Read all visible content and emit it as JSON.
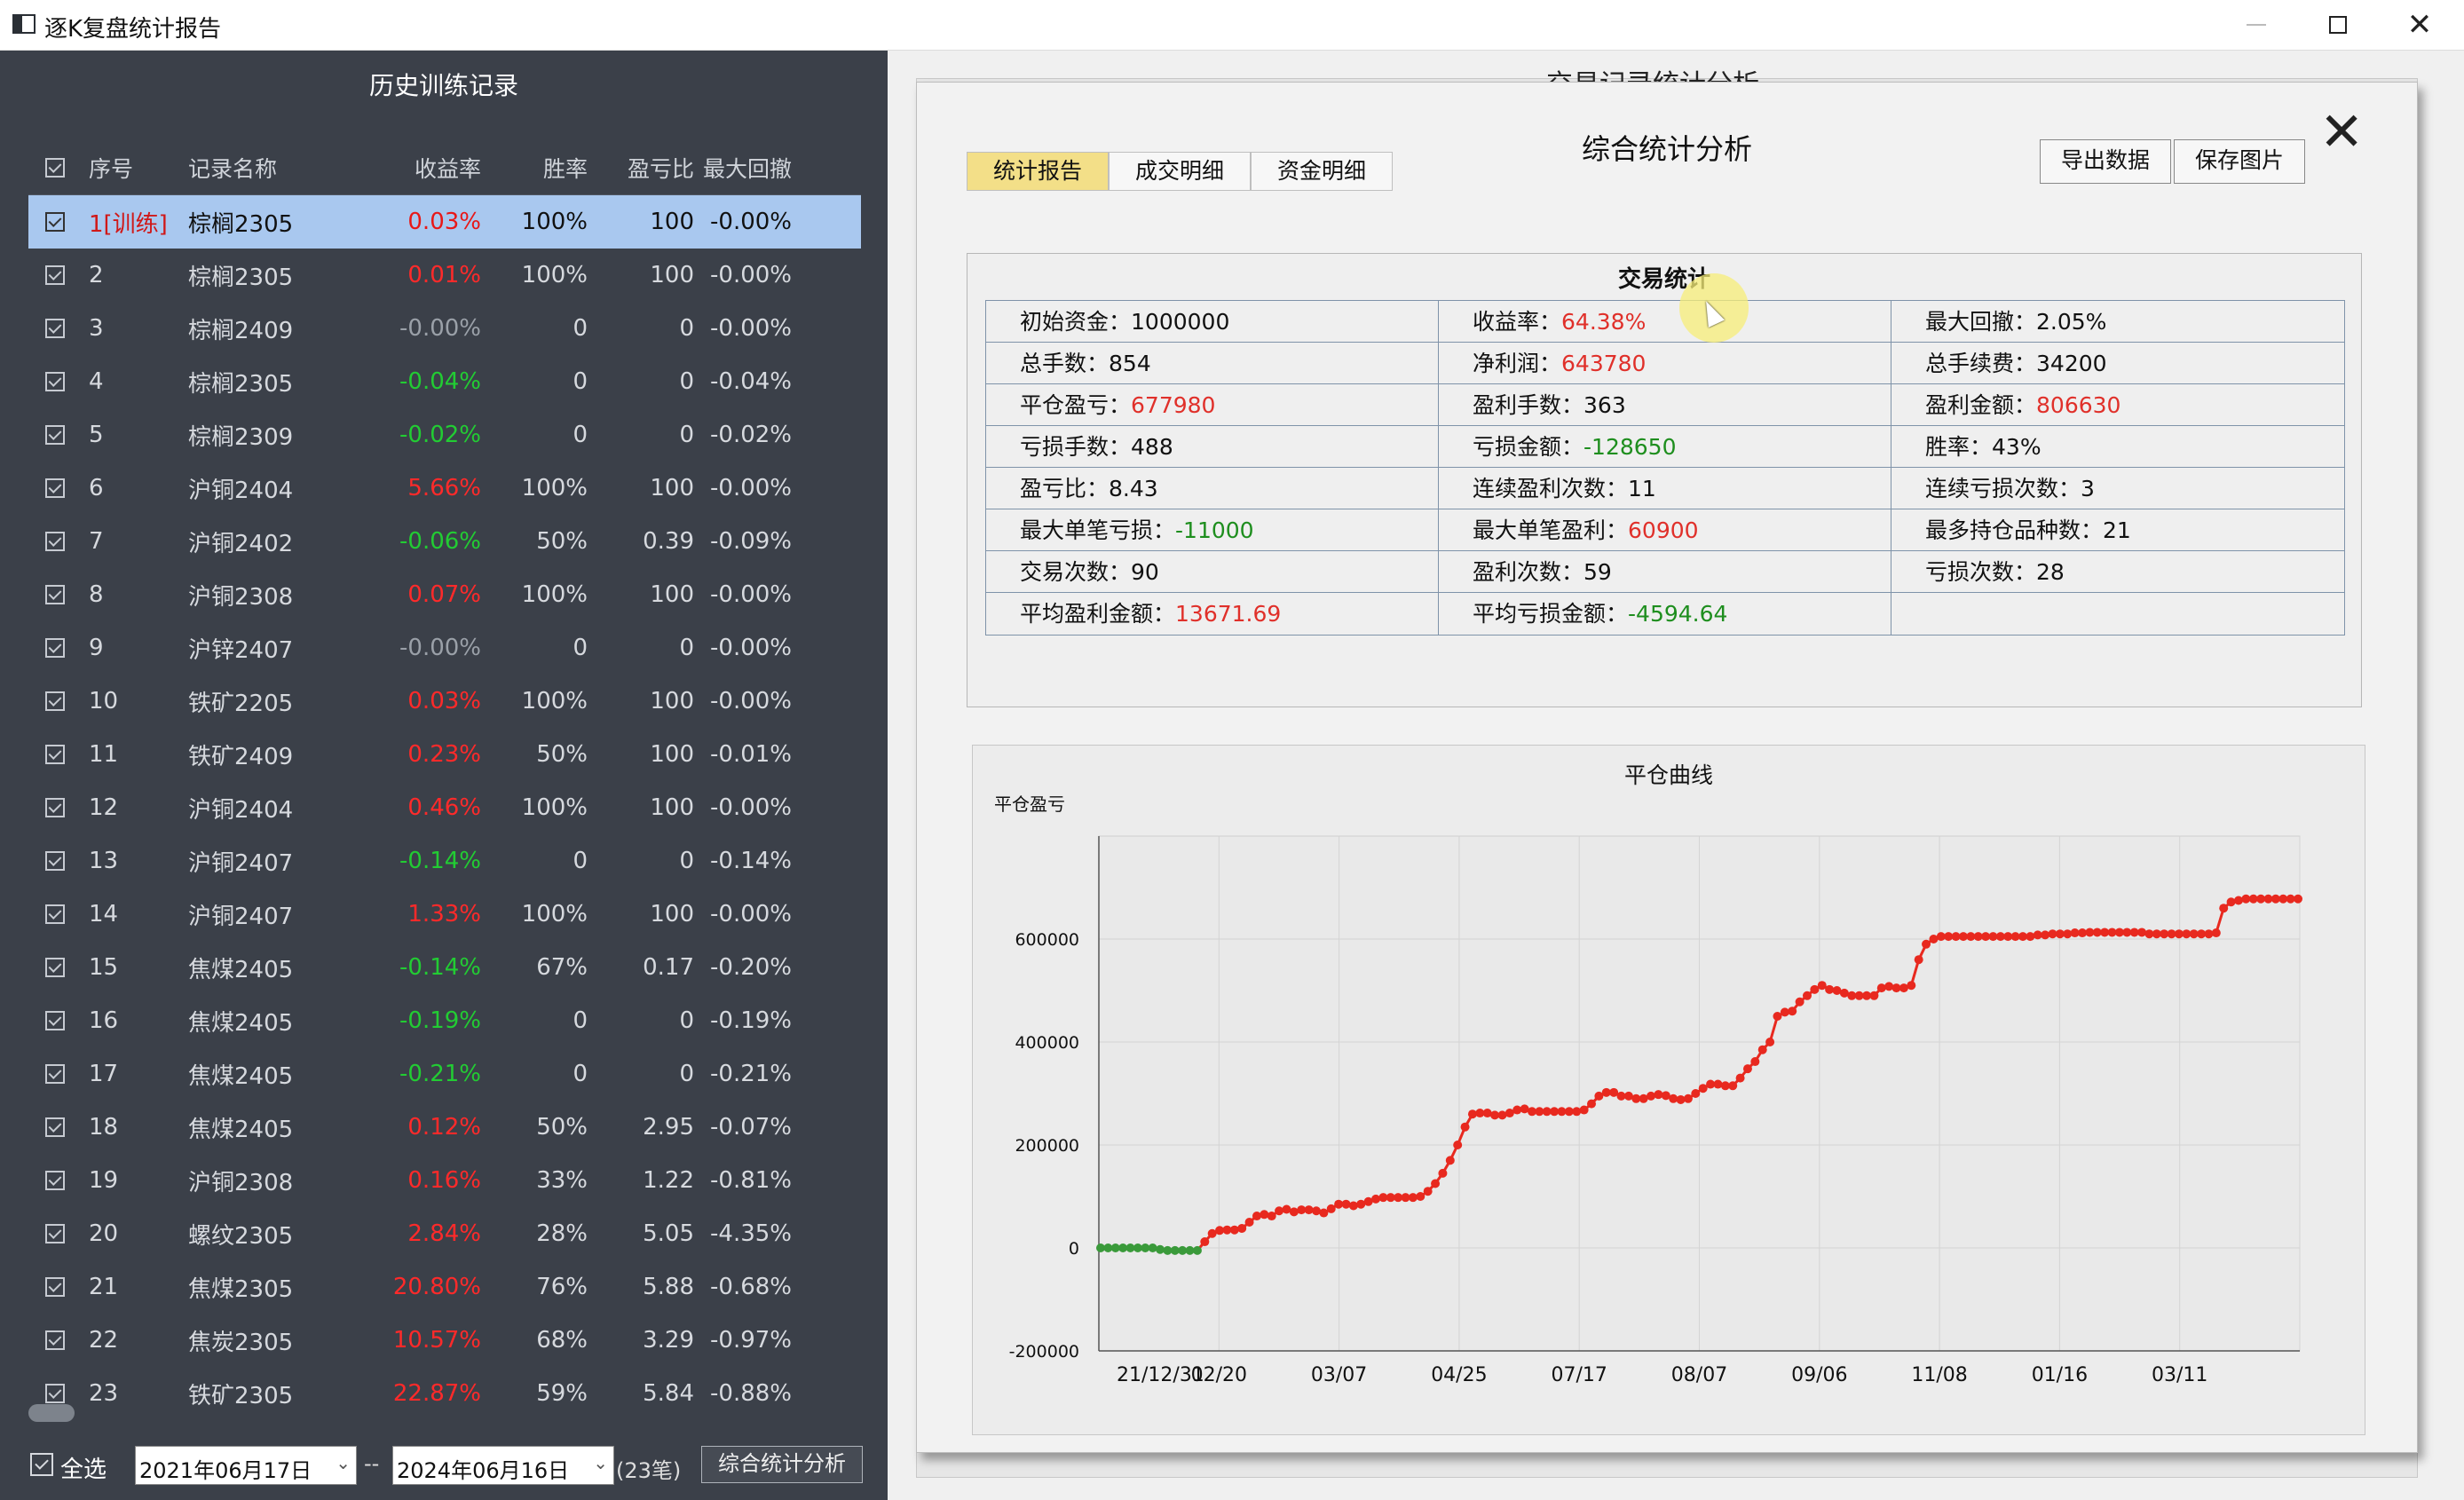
{
  "window": {
    "title": "逐K复盘统计报告"
  },
  "left_panel": {
    "title": "历史训练记录",
    "columns": [
      "序号",
      "记录名称",
      "收益率",
      "胜率",
      "盈亏比",
      "最大回撤"
    ],
    "rows": [
      {
        "no": "1[训练]",
        "name": "棕榈2305",
        "ret": "0.03%",
        "win": "100%",
        "ratio": "100",
        "dd": "-0.00%",
        "ret_color": "red"
      },
      {
        "no": "2",
        "name": "棕榈2305",
        "ret": "0.01%",
        "win": "100%",
        "ratio": "100",
        "dd": "-0.00%",
        "ret_color": "red"
      },
      {
        "no": "3",
        "name": "棕榈2409",
        "ret": "-0.00%",
        "win": "0",
        "ratio": "0",
        "dd": "-0.00%",
        "ret_color": "gray"
      },
      {
        "no": "4",
        "name": "棕榈2305",
        "ret": "-0.04%",
        "win": "0",
        "ratio": "0",
        "dd": "-0.04%",
        "ret_color": "green"
      },
      {
        "no": "5",
        "name": "棕榈2309",
        "ret": "-0.02%",
        "win": "0",
        "ratio": "0",
        "dd": "-0.02%",
        "ret_color": "green"
      },
      {
        "no": "6",
        "name": "沪铜2404",
        "ret": "5.66%",
        "win": "100%",
        "ratio": "100",
        "dd": "-0.00%",
        "ret_color": "red"
      },
      {
        "no": "7",
        "name": "沪铜2402",
        "ret": "-0.06%",
        "win": "50%",
        "ratio": "0.39",
        "dd": "-0.09%",
        "ret_color": "green"
      },
      {
        "no": "8",
        "name": "沪铜2308",
        "ret": "0.07%",
        "win": "100%",
        "ratio": "100",
        "dd": "-0.00%",
        "ret_color": "red"
      },
      {
        "no": "9",
        "name": "沪锌2407",
        "ret": "-0.00%",
        "win": "0",
        "ratio": "0",
        "dd": "-0.00%",
        "ret_color": "gray"
      },
      {
        "no": "10",
        "name": "铁矿2205",
        "ret": "0.03%",
        "win": "100%",
        "ratio": "100",
        "dd": "-0.00%",
        "ret_color": "red"
      },
      {
        "no": "11",
        "name": "铁矿2409",
        "ret": "0.23%",
        "win": "50%",
        "ratio": "100",
        "dd": "-0.01%",
        "ret_color": "red"
      },
      {
        "no": "12",
        "name": "沪铜2404",
        "ret": "0.46%",
        "win": "100%",
        "ratio": "100",
        "dd": "-0.00%",
        "ret_color": "red"
      },
      {
        "no": "13",
        "name": "沪铜2407",
        "ret": "-0.14%",
        "win": "0",
        "ratio": "0",
        "dd": "-0.14%",
        "ret_color": "green"
      },
      {
        "no": "14",
        "name": "沪铜2407",
        "ret": "1.33%",
        "win": "100%",
        "ratio": "100",
        "dd": "-0.00%",
        "ret_color": "red"
      },
      {
        "no": "15",
        "name": "焦煤2405",
        "ret": "-0.14%",
        "win": "67%",
        "ratio": "0.17",
        "dd": "-0.20%",
        "ret_color": "green"
      },
      {
        "no": "16",
        "name": "焦煤2405",
        "ret": "-0.19%",
        "win": "0",
        "ratio": "0",
        "dd": "-0.19%",
        "ret_color": "green"
      },
      {
        "no": "17",
        "name": "焦煤2405",
        "ret": "-0.21%",
        "win": "0",
        "ratio": "0",
        "dd": "-0.21%",
        "ret_color": "green"
      },
      {
        "no": "18",
        "name": "焦煤2405",
        "ret": "0.12%",
        "win": "50%",
        "ratio": "2.95",
        "dd": "-0.07%",
        "ret_color": "red"
      },
      {
        "no": "19",
        "name": "沪铜2308",
        "ret": "0.16%",
        "win": "33%",
        "ratio": "1.22",
        "dd": "-0.81%",
        "ret_color": "red"
      },
      {
        "no": "20",
        "name": "螺纹2305",
        "ret": "2.84%",
        "win": "28%",
        "ratio": "5.05",
        "dd": "-4.35%",
        "ret_color": "red"
      },
      {
        "no": "21",
        "name": "焦煤2305",
        "ret": "20.80%",
        "win": "76%",
        "ratio": "5.88",
        "dd": "-0.68%",
        "ret_color": "red"
      },
      {
        "no": "22",
        "name": "焦炭2305",
        "ret": "10.57%",
        "win": "68%",
        "ratio": "3.29",
        "dd": "-0.97%",
        "ret_color": "red"
      },
      {
        "no": "23",
        "name": "铁矿2305",
        "ret": "22.87%",
        "win": "59%",
        "ratio": "5.84",
        "dd": "-0.88%",
        "ret_color": "red"
      }
    ],
    "select_all_label": "全选",
    "date_from": "2021年06月17日",
    "date_separator": "--",
    "date_to": "2024年06月16日",
    "count": "(23笔)",
    "analyze_button": "综合统计分析"
  },
  "background_dialog": {
    "title": "交易记录统计分析"
  },
  "dialog": {
    "title": "综合统计分析",
    "close_glyph": "✕",
    "tabs": [
      "统计报告",
      "成交明细",
      "资金明细"
    ],
    "export_button": "导出数据",
    "save_button": "保存图片",
    "stats_title": "交易统计",
    "stats": [
      {
        "label": "初始资金：",
        "value": "1000000",
        "color": ""
      },
      {
        "label": "收益率：",
        "value": "64.38%",
        "color": "red"
      },
      {
        "label": "最大回撤：",
        "value": "2.05%",
        "color": ""
      },
      {
        "label": "总手数：",
        "value": "854",
        "color": ""
      },
      {
        "label": "净利润：",
        "value": "643780",
        "color": "red"
      },
      {
        "label": "总手续费：",
        "value": "34200",
        "color": ""
      },
      {
        "label": "平仓盈亏：",
        "value": "677980",
        "color": "red"
      },
      {
        "label": "盈利手数：",
        "value": "363",
        "color": ""
      },
      {
        "label": "盈利金额：",
        "value": "806630",
        "color": "red"
      },
      {
        "label": "亏损手数：",
        "value": "488",
        "color": ""
      },
      {
        "label": "亏损金额：",
        "value": "-128650",
        "color": "green"
      },
      {
        "label": "胜率：",
        "value": "43%",
        "color": ""
      },
      {
        "label": "盈亏比：",
        "value": "8.43",
        "color": ""
      },
      {
        "label": "连续盈利次数：",
        "value": "11",
        "color": ""
      },
      {
        "label": "连续亏损次数：",
        "value": "3",
        "color": ""
      },
      {
        "label": "最大单笔亏损：",
        "value": "-11000",
        "color": "green"
      },
      {
        "label": "最大单笔盈利：",
        "value": "60900",
        "color": "red"
      },
      {
        "label": "最多持仓品种数：",
        "value": "21",
        "color": ""
      },
      {
        "label": "交易次数：",
        "value": "90",
        "color": ""
      },
      {
        "label": "盈利次数：",
        "value": "59",
        "color": ""
      },
      {
        "label": "亏损次数：",
        "value": "28",
        "color": ""
      },
      {
        "label": "平均盈利金额：",
        "value": "13671.69",
        "color": "red"
      },
      {
        "label": "平均亏损金额：",
        "value": "-4594.64",
        "color": "green"
      },
      {
        "label": "",
        "value": "",
        "color": ""
      }
    ]
  },
  "colors": {
    "profit_red": "#e0302a",
    "loss_green": "#1e8e1e",
    "tab_active": "#f3df88",
    "selected_row": "#a9c8ef",
    "curve_red": "#e8291f",
    "curve_green": "#3a9a3a"
  },
  "chart_data": {
    "type": "line",
    "title": "平仓曲线",
    "ylabel": "平仓盈亏",
    "xlabel": "",
    "ylim": [
      -200000,
      800000
    ],
    "yticks": [
      600000,
      400000,
      200000,
      0,
      -200000
    ],
    "xtick_labels": [
      "21/12/31",
      "02/20",
      "03/07",
      "04/25",
      "07/17",
      "08/07",
      "09/06",
      "11/08",
      "01/16",
      "03/11"
    ],
    "grid": true,
    "series": [
      {
        "values": [
          0,
          0,
          0,
          0,
          0,
          0,
          0,
          0,
          -3000,
          -5000,
          -5000,
          -5000,
          -5000,
          -5000,
          12000,
          28000,
          34000,
          35000,
          35000,
          38000,
          50000,
          62000,
          65000,
          62000,
          72000,
          75000,
          70000,
          74000,
          74000,
          72000,
          68000,
          76000,
          85000,
          85000,
          82000,
          85000,
          90000,
          95000,
          98000,
          98000,
          98000,
          98000,
          98000,
          100000,
          110000,
          125000,
          145000,
          170000,
          200000,
          235000,
          260000,
          262000,
          262000,
          258000,
          258000,
          262000,
          268000,
          270000,
          265000,
          265000,
          265000,
          265000,
          265000,
          265000,
          265000,
          268000,
          280000,
          295000,
          302000,
          302000,
          295000,
          295000,
          290000,
          290000,
          295000,
          298000,
          296000,
          290000,
          288000,
          290000,
          300000,
          310000,
          318000,
          318000,
          315000,
          315000,
          330000,
          348000,
          362000,
          385000,
          400000,
          450000,
          458000,
          460000,
          478000,
          490000,
          502000,
          510000,
          502000,
          500000,
          495000,
          490000,
          490000,
          490000,
          490000,
          505000,
          508000,
          505000,
          505000,
          510000,
          560000,
          590000,
          600000,
          605000,
          605000,
          605000,
          605000,
          605000,
          605000,
          605000,
          605000,
          605000,
          605000,
          605000,
          605000,
          605000,
          608000,
          608000,
          610000,
          610000,
          610000,
          612000,
          612000,
          613000,
          613000,
          613000,
          613000,
          613000,
          613000,
          613000,
          613000,
          610000,
          610000,
          610000,
          610000,
          610000,
          610000,
          610000,
          610000,
          610000,
          612000,
          660000,
          672000,
          675000,
          678000,
          678000,
          678000,
          678000,
          678000,
          678000,
          678000,
          678000
        ]
      }
    ]
  }
}
